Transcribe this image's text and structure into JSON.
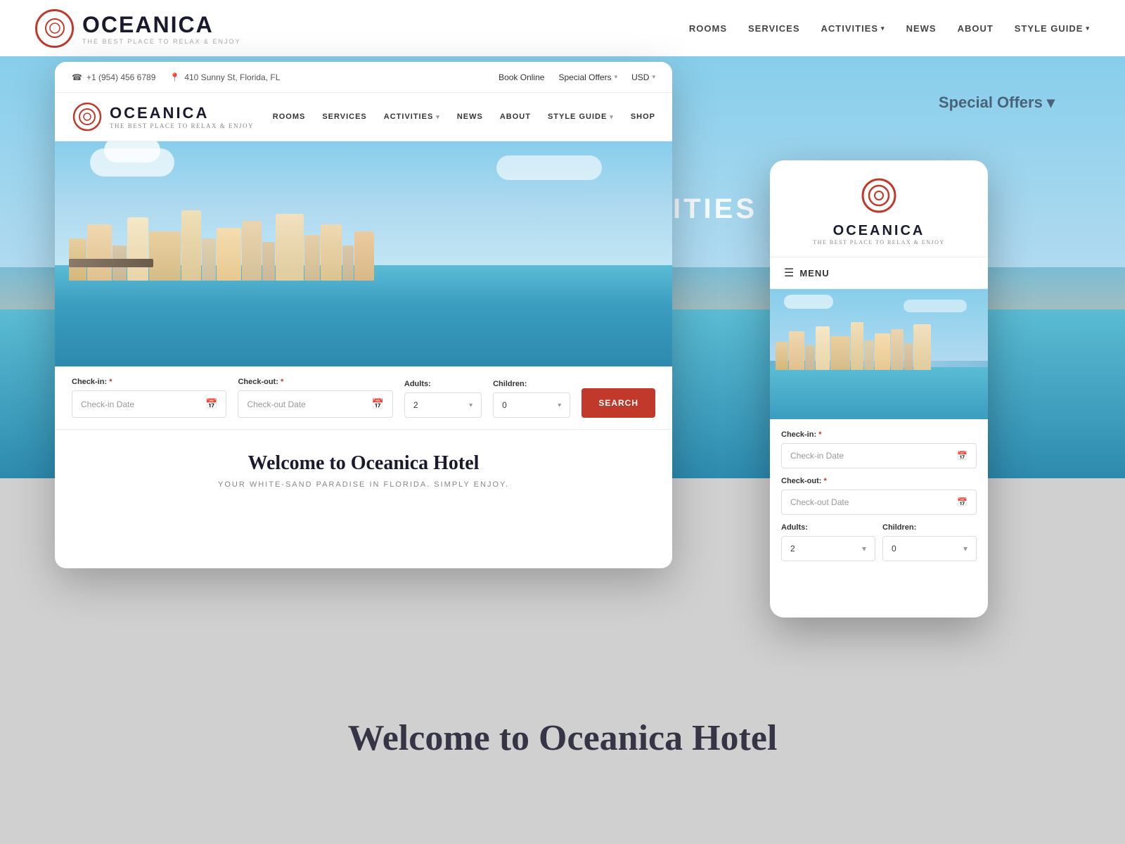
{
  "brand": {
    "name": "OCEANICA",
    "tagline": "THE BEST PLACE TO RELAX & ENJOY",
    "logo_letter": "O"
  },
  "background": {
    "nav": {
      "links": [
        "ROOMS",
        "SERVICES",
        "ACTIVITIES",
        "NEWS",
        "ABOUT",
        "STYLE GUIDE"
      ]
    },
    "activities_text": "AcTivITIES",
    "welcome_title": "Welcome to Oceanica Hotel"
  },
  "topbar": {
    "phone": "+1 (954) 456 6789",
    "address": "410 Sunny St, Florida, FL",
    "book_online": "Book Online",
    "special_offers": "Special Offers",
    "currency": "USD"
  },
  "desktop": {
    "nav": {
      "items": [
        {
          "label": "ROOMS",
          "has_dropdown": false
        },
        {
          "label": "SERVICES",
          "has_dropdown": false
        },
        {
          "label": "ACTIVITIES",
          "has_dropdown": true
        },
        {
          "label": "NEWS",
          "has_dropdown": false
        },
        {
          "label": "ABOUT",
          "has_dropdown": false
        },
        {
          "label": "STYLE GUIDE",
          "has_dropdown": true
        },
        {
          "label": "SHOP",
          "has_dropdown": false
        }
      ]
    },
    "booking": {
      "checkin_label": "Check-in:",
      "checkout_label": "Check-out:",
      "adults_label": "Adults:",
      "children_label": "Children:",
      "checkin_placeholder": "Check-in Date",
      "checkout_placeholder": "Check-out Date",
      "adults_value": "2",
      "children_value": "0",
      "search_button": "SEARCH",
      "required_marker": "*"
    },
    "content": {
      "title": "Welcome to Oceanica Hotel",
      "subtitle": "YOUR WHITE-SAND PARADISE IN FLORIDA. SIMPLY ENJOY."
    }
  },
  "mobile": {
    "menu_label": "MENU",
    "booking": {
      "checkin_label": "Check-in:",
      "checkout_label": "Check-out:",
      "adults_label": "Adults:",
      "children_label": "Children:",
      "checkin_placeholder": "Check-in Date",
      "checkout_placeholder": "Check-out Date",
      "adults_value": "2",
      "children_value": "0",
      "required_marker": "*"
    }
  },
  "bottom": {
    "title": "Welcome to Oceanica Hotel"
  },
  "colors": {
    "accent": "#c0392b",
    "dark": "#1a1a2e",
    "light_gray": "#d0d0d0"
  }
}
